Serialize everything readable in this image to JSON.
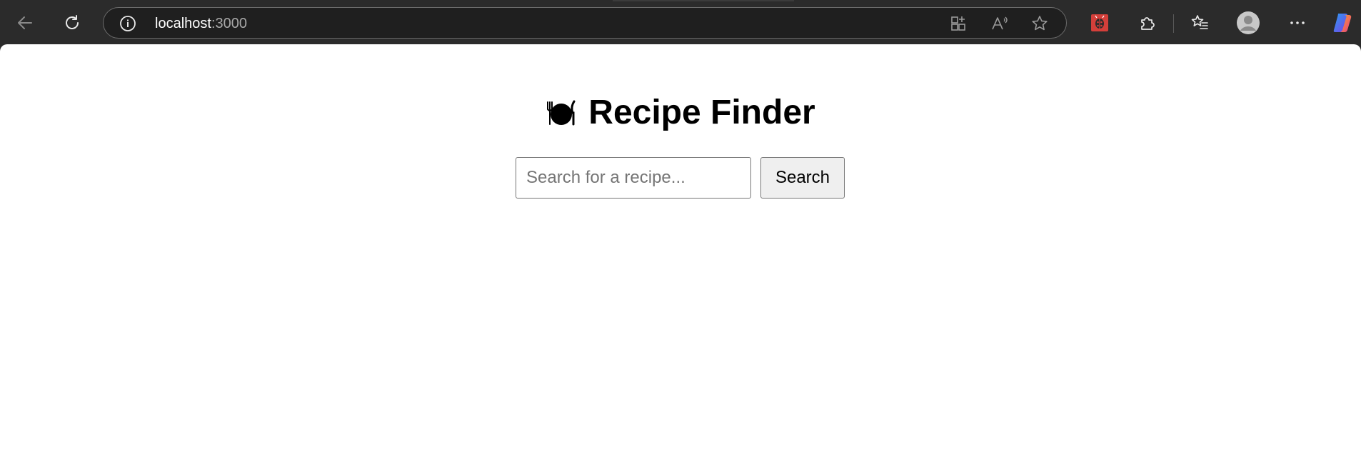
{
  "browser": {
    "url_host": "localhost",
    "url_port": ":3000",
    "icons": {
      "back": "back-arrow-icon",
      "refresh": "refresh-icon",
      "site_info": "info-icon",
      "app_available": "app-available-icon",
      "read_aloud": "read-aloud-icon",
      "favorite": "star-icon",
      "extension": "extension-ladybug-icon",
      "extensions": "puzzle-icon",
      "favorites": "favorites-list-icon",
      "profile": "profile-avatar-icon",
      "more": "more-dots-icon",
      "copilot": "copilot-icon"
    },
    "colors": {
      "toolbar": "#2b2b2b",
      "address_bar": "#1f1f1f",
      "extension_red": "#d43f3a"
    }
  },
  "page": {
    "title": "Recipe Finder",
    "title_icon": "plate-fork-knife-icon",
    "search": {
      "placeholder": "Search for a recipe...",
      "value": "",
      "button_label": "Search"
    }
  }
}
